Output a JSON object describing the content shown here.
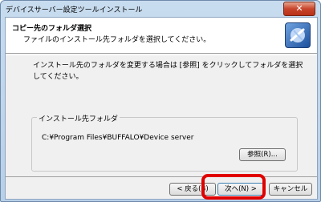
{
  "window": {
    "title": "デバイスサーバー設定ツールインストール",
    "close_label": "✕"
  },
  "header": {
    "title": "コピー先のフォルダ選択",
    "subtitle": "ファイルのインストール先フォルダを選択してください。"
  },
  "main": {
    "description": "インストール先のフォルダを変更する場合は [参照] をクリックしてフォルダを選択してください。",
    "group_label": "インストール先フォルダ",
    "path": "C:¥Program Files¥BUFFALO¥Device server",
    "browse_label": "参照(R)..."
  },
  "buttons": {
    "back_label": "< 戻る(B)",
    "next_label": "次へ(N) >",
    "cancel_label": "キャンセル"
  },
  "colors": {
    "highlight": "#e00000",
    "close_button": "#c7452b"
  },
  "icons": [
    "app-icon",
    "installer-logo-icon",
    "close-icon"
  ]
}
